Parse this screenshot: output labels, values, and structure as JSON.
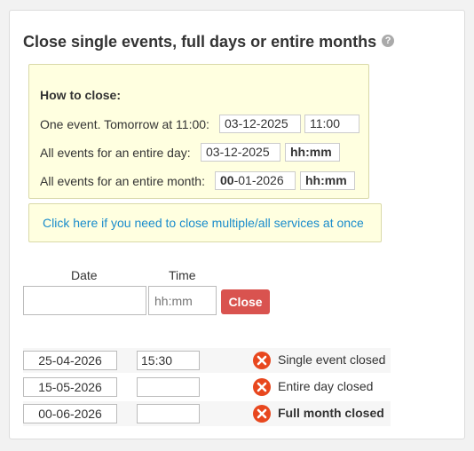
{
  "title": "Close single events, full days or entire months",
  "help_glyph": "?",
  "howto": {
    "heading": "How to close:",
    "event_label": "One event. Tomorrow at 11:00:",
    "event_date": "03-12-2025",
    "event_time": "11:00",
    "day_label": "All events for an entire day:",
    "day_date": "03-12-2025",
    "day_time": "hh:mm",
    "month_label": "All events for an entire month:",
    "month_date_prefix": "00",
    "month_date_rest": "-01-2026",
    "month_time": "hh:mm"
  },
  "multi_link": "Click here if you need to close multiple/all services at once",
  "form": {
    "date_label": "Date",
    "time_label": "Time",
    "date_value": "",
    "time_placeholder": "hh:mm",
    "close_label": "Close"
  },
  "closures": [
    {
      "date": "25-04-2026",
      "time": "15:30",
      "status": "Single event closed"
    },
    {
      "date": "15-05-2026",
      "time": "",
      "status": "Entire day closed"
    },
    {
      "date": "00-06-2026",
      "time": "",
      "status": "Full month closed"
    }
  ],
  "colors": {
    "close_button": "#d9534f",
    "remove_icon": "#e8471e",
    "link": "#1a8ccc",
    "note_bg": "#ffffe0"
  }
}
